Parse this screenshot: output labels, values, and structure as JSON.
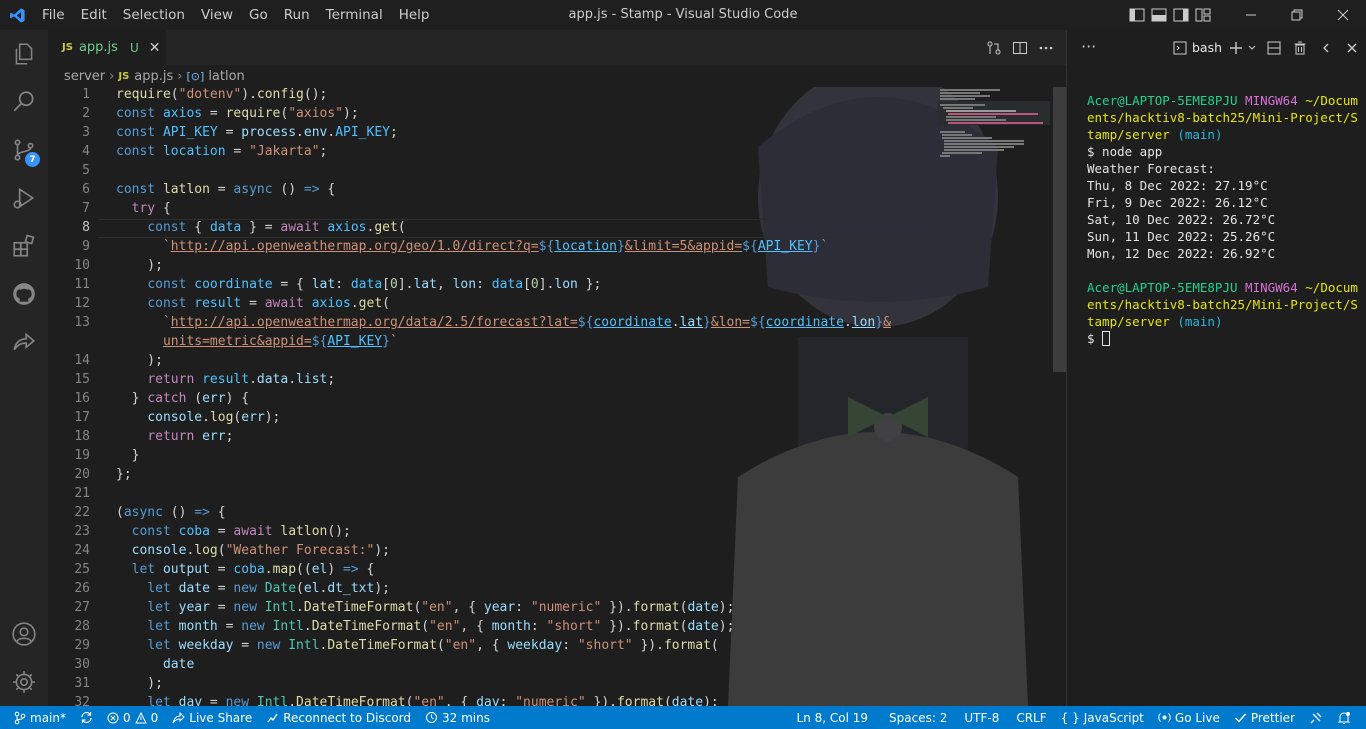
{
  "titlebar": {
    "menu": [
      "File",
      "Edit",
      "Selection",
      "View",
      "Go",
      "Run",
      "Terminal",
      "Help"
    ],
    "title": "app.js - Stamp - Visual Studio Code"
  },
  "activity": {
    "items": [
      "explorer-icon",
      "search-icon",
      "source-control-icon",
      "run-debug-icon",
      "extensions-icon",
      "github-icon",
      "live-share-icon"
    ],
    "source_control_badge": "7",
    "bottom": [
      "account-icon",
      "settings-gear-icon"
    ]
  },
  "editor": {
    "tab": {
      "badge": "JS",
      "name": "app.js",
      "status": "U",
      "close": "✕"
    },
    "breadcrumb": {
      "folder": "server",
      "file_badge": "JS",
      "file": "app.js",
      "symbol": "latlon"
    },
    "line_numbers": [
      "1",
      "2",
      "3",
      "4",
      "5",
      "6",
      "7",
      "8",
      "9",
      "10",
      "11",
      "12",
      "13",
      "",
      "14",
      "15",
      "16",
      "17",
      "18",
      "19",
      "20",
      "21",
      "22",
      "23",
      "24",
      "25",
      "26",
      "27",
      "28",
      "29",
      "30",
      "31",
      "32"
    ]
  },
  "terminal": {
    "menu": "···",
    "tab_label": "bash",
    "prompt_user": "Acer@LAPTOP-5EME8PJU",
    "prompt_env": "MINGW64",
    "prompt_path": "~/Documents/hacktiv8-batch25/Mini-Project/Stamp/server",
    "prompt_branch": "(main)",
    "command": "$ node app",
    "output": [
      "Weather Forecast:",
      "Thu, 8 Dec 2022: 27.19°C",
      "Fri, 9 Dec 2022: 26.12°C",
      "Sat, 10 Dec 2022: 26.72°C",
      "Sun, 11 Dec 2022: 25.26°C",
      "Mon, 12 Dec 2022: 26.92°C"
    ],
    "prompt_symbol": "$"
  },
  "statusbar": {
    "branch": "main*",
    "errors": "0",
    "warnings": "0",
    "live_share": "Live Share",
    "discord": "Reconnect to Discord",
    "time": "32 mins",
    "position": "Ln 8, Col 19",
    "spaces": "Spaces: 2",
    "encoding": "UTF-8",
    "eol": "CRLF",
    "language": "JavaScript",
    "go_live": "Go Live",
    "prettier": "Prettier"
  },
  "colors": {
    "statusbar": "#007acc",
    "activity_bar": "#252526",
    "editor_bg": "#1e1e1e",
    "accent_badge": "#3794ff"
  }
}
